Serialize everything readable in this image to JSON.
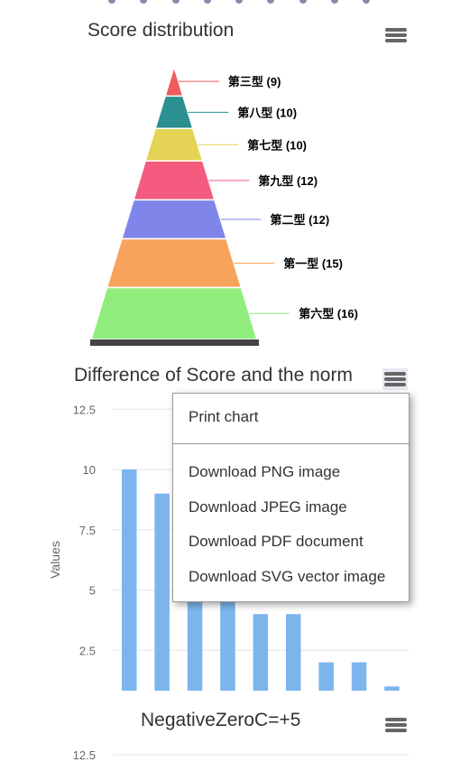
{
  "chart_data": [
    {
      "type": "funnel",
      "title": "Score distribution",
      "categories": [
        "第三型",
        "第八型",
        "第七型",
        "第九型",
        "第二型",
        "第一型",
        "第六型"
      ],
      "values": [
        9,
        10,
        10,
        12,
        12,
        15,
        16
      ],
      "labels": [
        "第三型 (9)",
        "第八型 (10)",
        "第七型 (10)",
        "第九型 (12)",
        "第二型 (12)",
        "第一型 (15)",
        "第六型 (16)"
      ],
      "colors": [
        "#f15c5c",
        "#2b908f",
        "#e4d354",
        "#f45b7f",
        "#8085e9",
        "#f7a35c",
        "#90ed7d"
      ]
    },
    {
      "type": "bar",
      "title": "Difference of Score and the norm",
      "ylabel": "Values",
      "yticks": [
        "2.5",
        "5",
        "7.5",
        "10",
        "12.5"
      ],
      "ylim": [
        0.8,
        12.5
      ],
      "values": [
        10,
        9,
        6,
        5,
        4,
        4,
        2,
        2,
        1
      ],
      "color": "#7cb5ec",
      "grid": true
    },
    {
      "type": "bar",
      "title": "NegativeZeroC=+5",
      "yticks": [
        "12.5"
      ]
    }
  ],
  "menu": {
    "items": [
      "Print chart",
      "Download PNG image",
      "Download JPEG image",
      "Download PDF document",
      "Download SVG vector image"
    ]
  }
}
